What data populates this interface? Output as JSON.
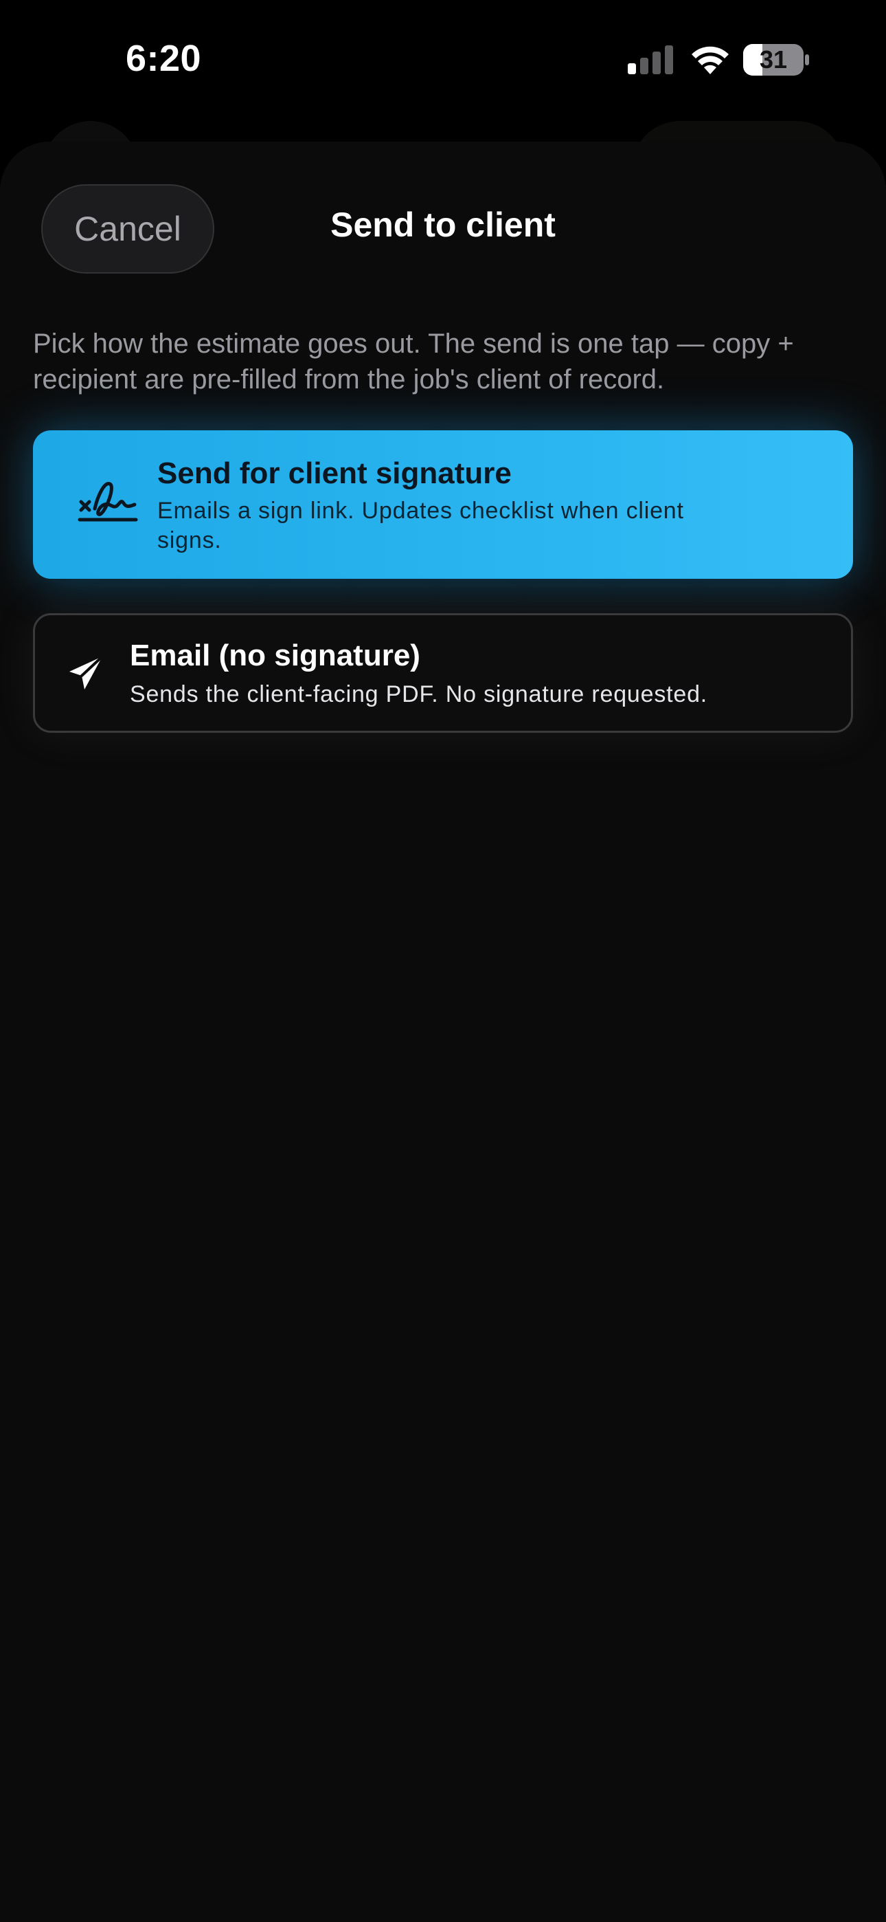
{
  "status_bar": {
    "time": "6:20",
    "battery_level": "31",
    "icons": [
      "cellular-signal-icon",
      "wifi-icon",
      "battery-icon"
    ]
  },
  "sheet": {
    "cancel_label": "Cancel",
    "title": "Send to client",
    "description": "Pick how the estimate goes out. The send is one tap — copy + recipient are pre-filled from the job's client of record.",
    "options": [
      {
        "icon": "signature-icon",
        "title": "Send for client signature",
        "description": "Emails a sign link. Updates checklist when client signs.",
        "selected": true
      },
      {
        "icon": "paper-plane-icon",
        "title": "Email (no signature)",
        "description": "Sends the client-facing PDF. No signature requested.",
        "selected": false
      }
    ]
  },
  "colors": {
    "background": "#000000",
    "sheet": "#0b0b0b",
    "accent": "#2ab5f0",
    "muted_text": "#9a9aa0"
  }
}
